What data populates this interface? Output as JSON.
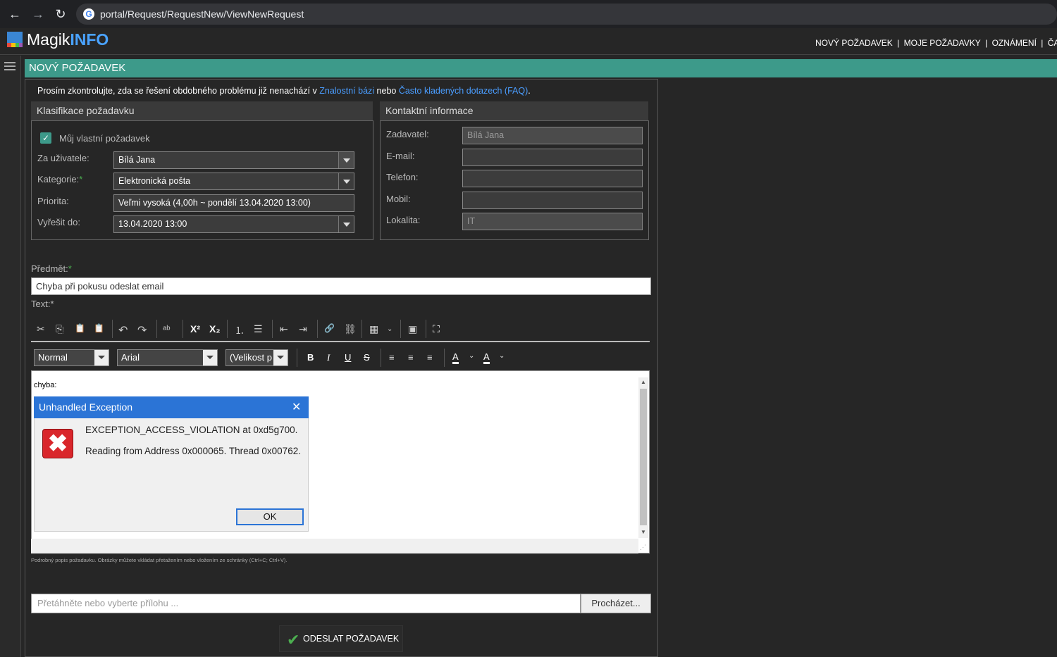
{
  "browser": {
    "url": "portal/Request/RequestNew/ViewNewRequest"
  },
  "app": {
    "logo_main": "Magik",
    "logo_accent": "INFO",
    "nav": [
      "NOVÝ POŽADAVEK",
      "|",
      "MOJE POŽADAVKY",
      "|",
      "OZNÁMENÍ",
      "|",
      "ČASTÉ DO"
    ]
  },
  "page": {
    "title": "NOVÝ POŽADAVEK",
    "notice_prefix": "Prosím zkontrolujte, zda se řešení obdobného problému již nenachází v ",
    "notice_link1": "Znalostní bázi",
    "notice_mid": " nebo ",
    "notice_link2": "Často kladených dotazech (FAQ)",
    "notice_suffix": "."
  },
  "classification": {
    "heading": "Klasifikace požadavku",
    "own_request_label": "Můj vlastní požadavek",
    "user_label": "Za uživatele:",
    "user_value": "Bílá Jana",
    "category_label": "Kategorie:",
    "category_value": "Elektronická pošta",
    "priority_label": "Priorita:",
    "priority_value": "Veľmi vysoká (4,00h ~ pondělí 13.04.2020 13:00)",
    "due_label": "Vyřešit do:",
    "due_value": "13.04.2020 13:00"
  },
  "contact": {
    "heading": "Kontaktní informace",
    "requester_label": "Zadavatel:",
    "requester_value": "Bílá Jana",
    "email_label": "E-mail:",
    "phone_label": "Telefon:",
    "mobile_label": "Mobil:",
    "location_label": "Lokalita:",
    "location_value": "IT"
  },
  "form": {
    "subject_label": "Předmět:",
    "subject_value": "Chyba při pokusu odeslat email",
    "text_label": "Text:*",
    "format_value": "Normal",
    "font_value": "Arial",
    "size_value": "(Velikost p",
    "editor_text": "chyba:",
    "hint": "Podrobný popis požadavku. Obrázky můžete vkládat přetažením nebo vložením ze schránky (Ctrl+C; Ctrl+V).",
    "attach_placeholder": "Přetáhněte nebo vyberte přílohu ...",
    "browse_label": "Procházet...",
    "submit_label": "ODESLAT POŽADAVEK"
  },
  "dialog": {
    "title": "Unhandled Exception",
    "line1": "EXCEPTION_ACCESS_VIOLATION at 0xd5g700.",
    "line2": "Reading from Address 0x000065. Thread 0x00762.",
    "ok_label": "OK"
  },
  "icons": {
    "cut": "✂",
    "copy": "⎘",
    "paste": "📋",
    "undo": "↶",
    "redo": "↷",
    "spell": "ᵃᵇ",
    "superscript": "X²",
    "subscript": "X₂",
    "ol": "⒈",
    "ul": "☰",
    "outdent": "⇤",
    "indent": "⇥",
    "link": "🔗",
    "unlink": "⛓",
    "table": "▦",
    "source": "▣",
    "maximize": "⛶",
    "bold": "B",
    "italic": "I",
    "underline": "U",
    "strike": "S",
    "align_left": "≡",
    "align_center": "≡",
    "align_right": "≡",
    "bgcolor": "A",
    "fgcolor": "A"
  },
  "colors": {
    "accent": "#3d9a8a",
    "link": "#4a9dff",
    "dialog_title": "#2b74d6",
    "error_icon": "#d9262b"
  }
}
